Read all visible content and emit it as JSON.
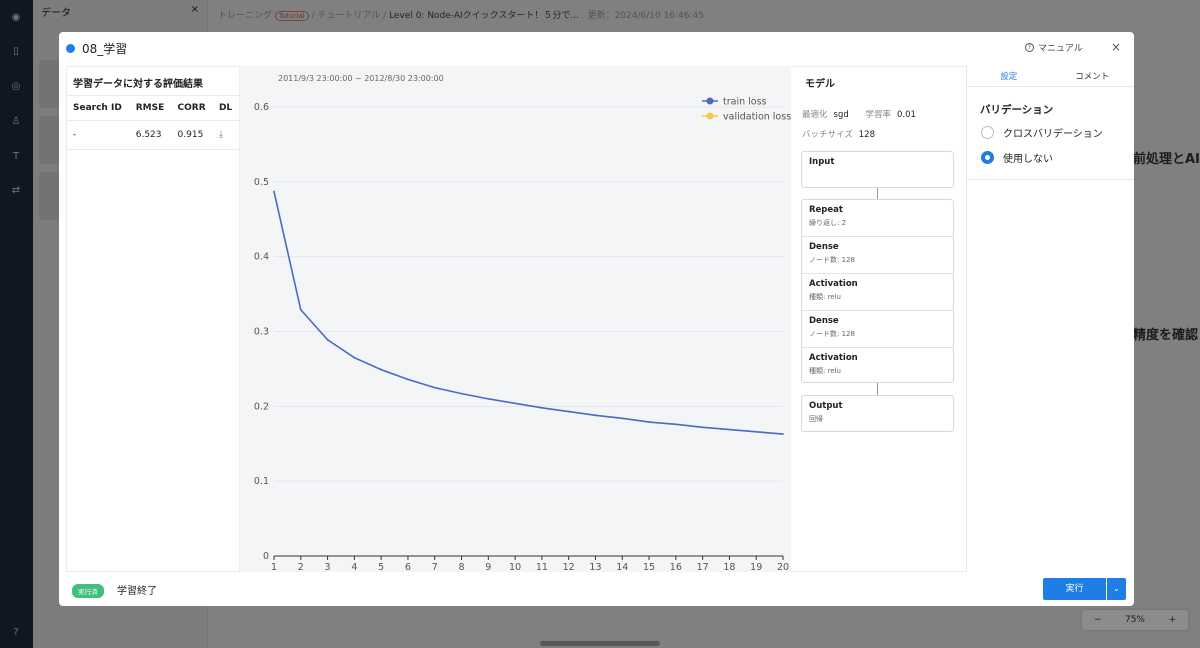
{
  "background": {
    "panel_title": "データ",
    "panel_close": "×",
    "breadcrumb_training": "トレーニング",
    "breadcrumb_tag": "Tutorial",
    "breadcrumb_tutorial": "/ チュートリアル /",
    "breadcrumb_current": "Level 0: Node-AIクイックスタート！５分で...",
    "updated": "更新：2024/6/10 16:46:45",
    "side_text_1": "前処理とAI",
    "side_text_2": "精度を確認",
    "zoom_value": "75%",
    "zoom_minus": "−",
    "zoom_plus": "+"
  },
  "modal": {
    "title": "08_学習",
    "manual_label": "マニュアル",
    "close": "×"
  },
  "eval": {
    "title": "学習データに対する評価結果",
    "columns": [
      "Search ID",
      "RMSE",
      "CORR",
      "DL"
    ],
    "rows": [
      {
        "search_id": "-",
        "rmse": "6.523",
        "corr": "0.915",
        "dl": "⤓"
      }
    ]
  },
  "chart": {
    "date_range": "2011/9/3 23:00:00 ~ 2012/8/30 23:00:00"
  },
  "chart_data": {
    "type": "line",
    "x": [
      1,
      2,
      3,
      4,
      5,
      6,
      7,
      8,
      9,
      10,
      11,
      12,
      13,
      14,
      15,
      16,
      17,
      18,
      19,
      20
    ],
    "series": [
      {
        "name": "train loss",
        "color": "#4a6bbf",
        "values": [
          0.487,
          0.329,
          0.289,
          0.265,
          0.249,
          0.236,
          0.225,
          0.217,
          0.21,
          0.204,
          0.198,
          0.193,
          0.188,
          0.184,
          0.179,
          0.176,
          0.172,
          0.169,
          0.166,
          0.163
        ]
      },
      {
        "name": "validation loss",
        "color": "#f2c94c",
        "values": []
      }
    ],
    "ylim": [
      0,
      0.6
    ],
    "yticks": [
      "0",
      "0.1",
      "0.2",
      "0.3",
      "0.4",
      "0.5",
      "0.6"
    ],
    "xticks": [
      "1",
      "2",
      "3",
      "4",
      "5",
      "6",
      "7",
      "8",
      "9",
      "10",
      "11",
      "12",
      "13",
      "14",
      "15",
      "16",
      "17",
      "18",
      "19",
      "20"
    ],
    "xlabel": "",
    "ylabel": "",
    "grid": true,
    "legend": "top-right"
  },
  "model": {
    "title": "モデル",
    "optimizer_label": "最適化",
    "optimizer_value": "sgd",
    "lr_label": "学習率",
    "lr_value": "0.01",
    "batch_label": "バッチサイズ",
    "batch_value": "128",
    "input": {
      "name": "Input"
    },
    "repeat_block": [
      {
        "name": "Repeat",
        "sub": "繰り返し: 2"
      },
      {
        "name": "Dense",
        "sub": "ノード数: 128"
      },
      {
        "name": "Activation",
        "sub": "種類: relu"
      },
      {
        "name": "Dense",
        "sub": "ノード数: 128"
      },
      {
        "name": "Activation",
        "sub": "種類: relu"
      }
    ],
    "output": {
      "name": "Output",
      "sub": "回帰"
    }
  },
  "settings": {
    "tabs": [
      "設定",
      "コメント"
    ],
    "active_tab": "設定",
    "validation_title": "バリデーション",
    "options": [
      "クロスバリデーション",
      "使用しない"
    ],
    "selected": "使用しない"
  },
  "footer": {
    "badge": "実行済",
    "status": "学習終了",
    "run_label": "実行",
    "dropdown": "⌄"
  },
  "colors": {
    "accent": "#1f7de6",
    "success": "#3fbf7f",
    "train_loss": "#4a6bbf",
    "validation_loss": "#f2c94c"
  }
}
